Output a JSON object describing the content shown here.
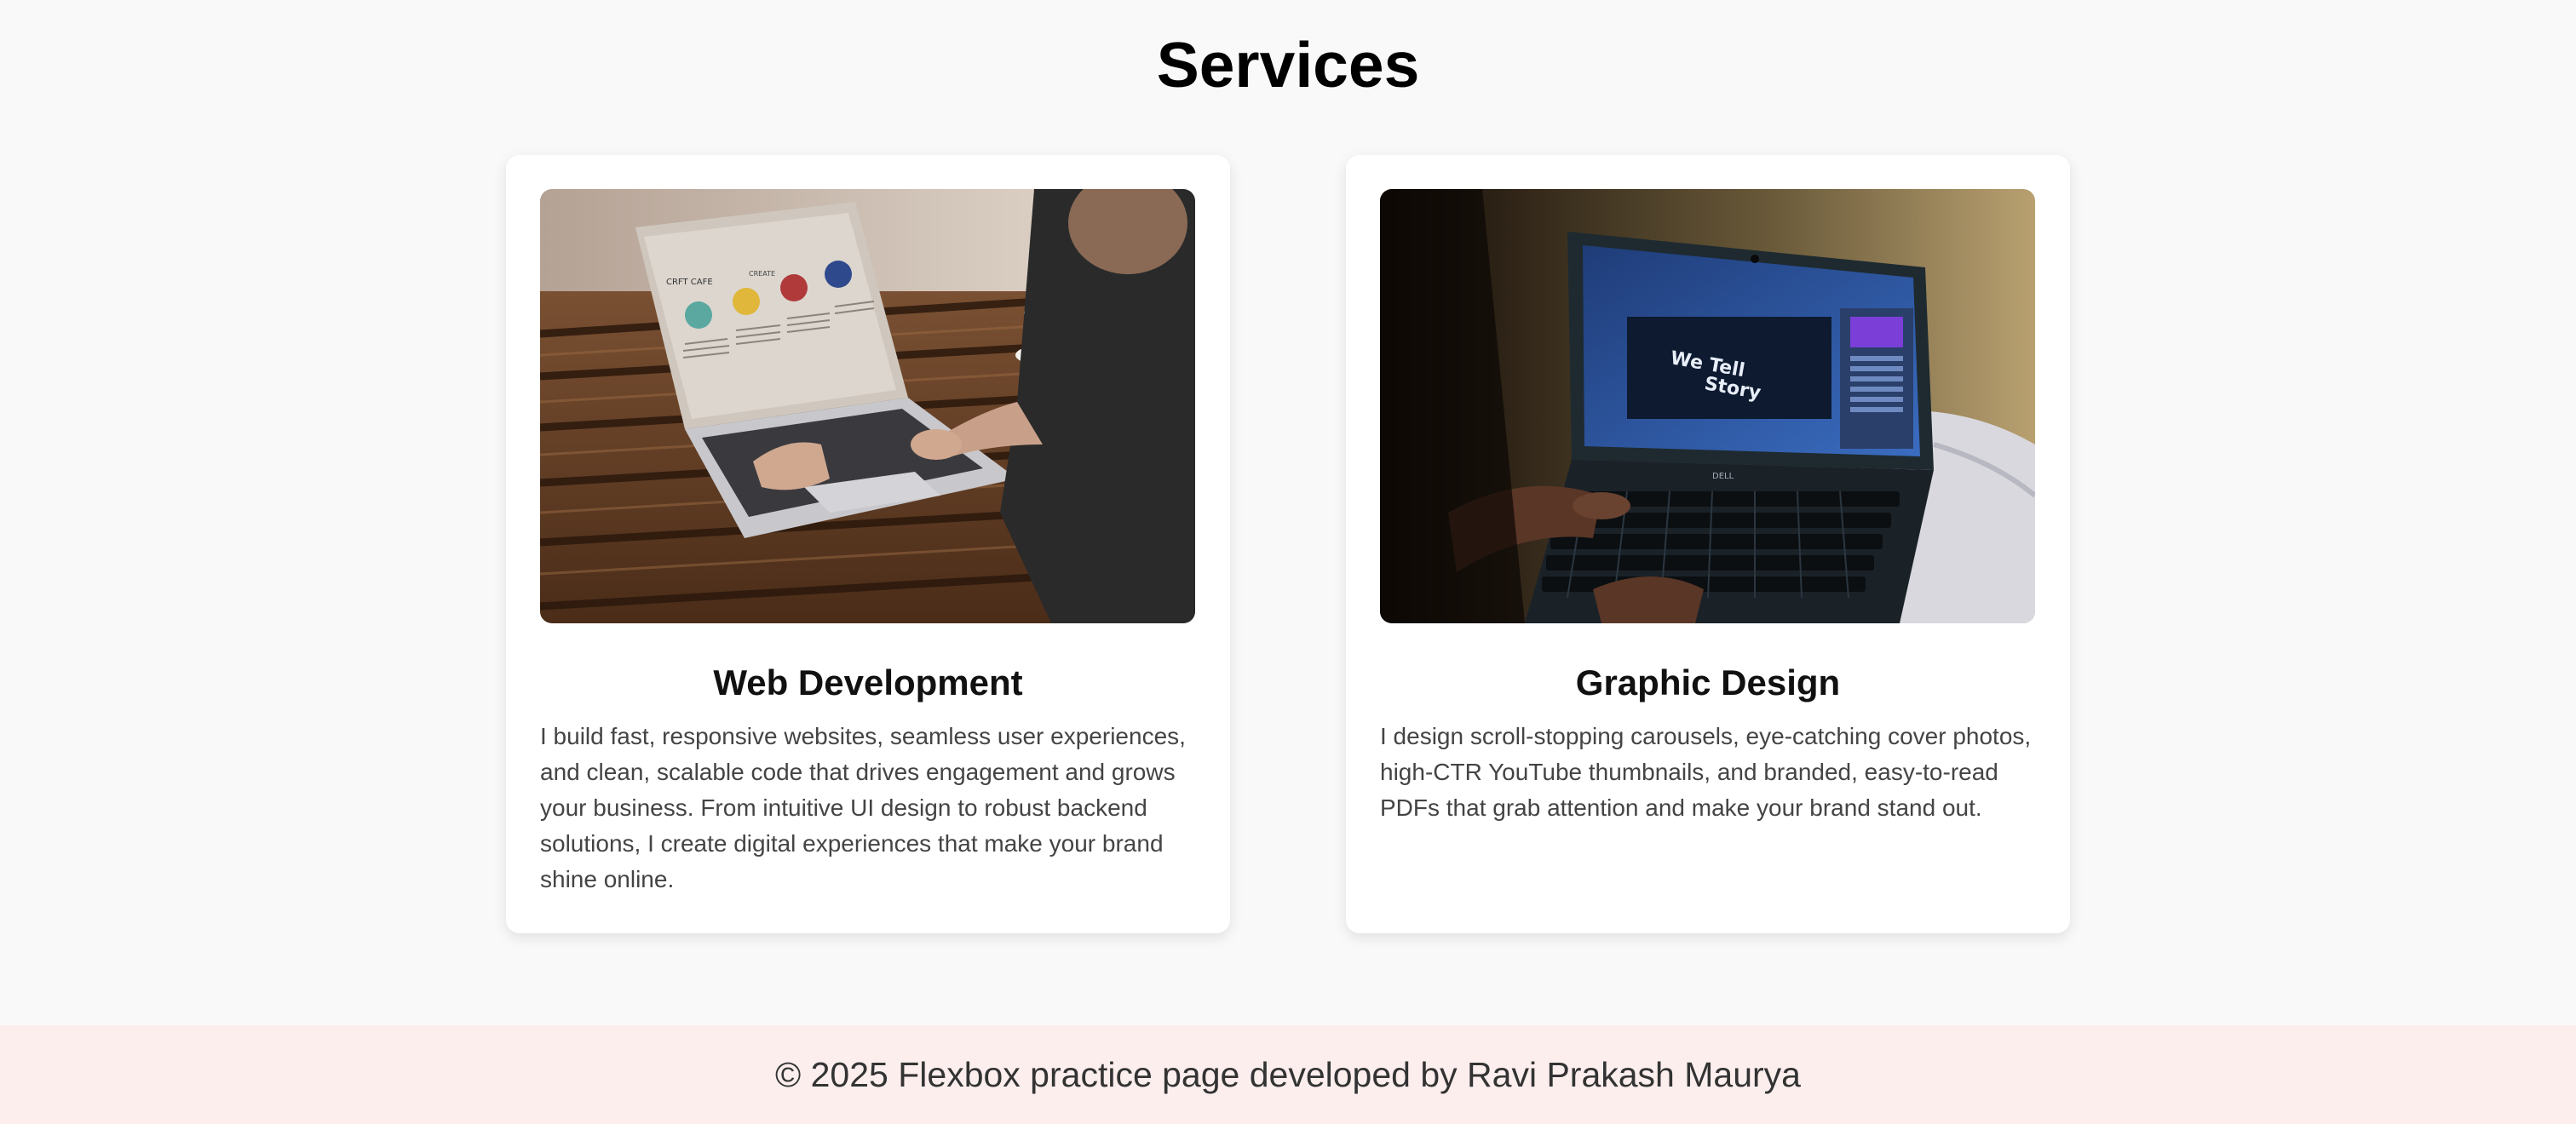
{
  "page": {
    "title": "Services"
  },
  "services": [
    {
      "title": "Web Development",
      "description": "I build fast, responsive websites, seamless user experiences, and clean, scalable code that drives engagement and grows your business. From intuitive UI design to robust backend solutions, I create digital experiences that make your brand shine online."
    },
    {
      "title": "Graphic Design",
      "description": "I design scroll-stopping carousels, eye-catching cover photos, high-CTR YouTube thumbnails, and branded, easy-to-read PDFs that grab attention and make your brand stand out."
    }
  ],
  "images": {
    "web": {
      "screen_brand": "CRFT CAFE",
      "screen_heading": "CREATE"
    },
    "graphic": {
      "laptop_brand": "DELL",
      "screen_text_1": "We Tell",
      "screen_text_2": "Story"
    }
  },
  "footer": {
    "text": "© 2025 Flexbox practice page developed by Ravi Prakash Maurya"
  },
  "colors": {
    "page_background": "#f9f9f9",
    "card_background": "#ffffff",
    "footer_background": "#fdeeee",
    "title_text": "#000000",
    "body_text": "#444444"
  }
}
